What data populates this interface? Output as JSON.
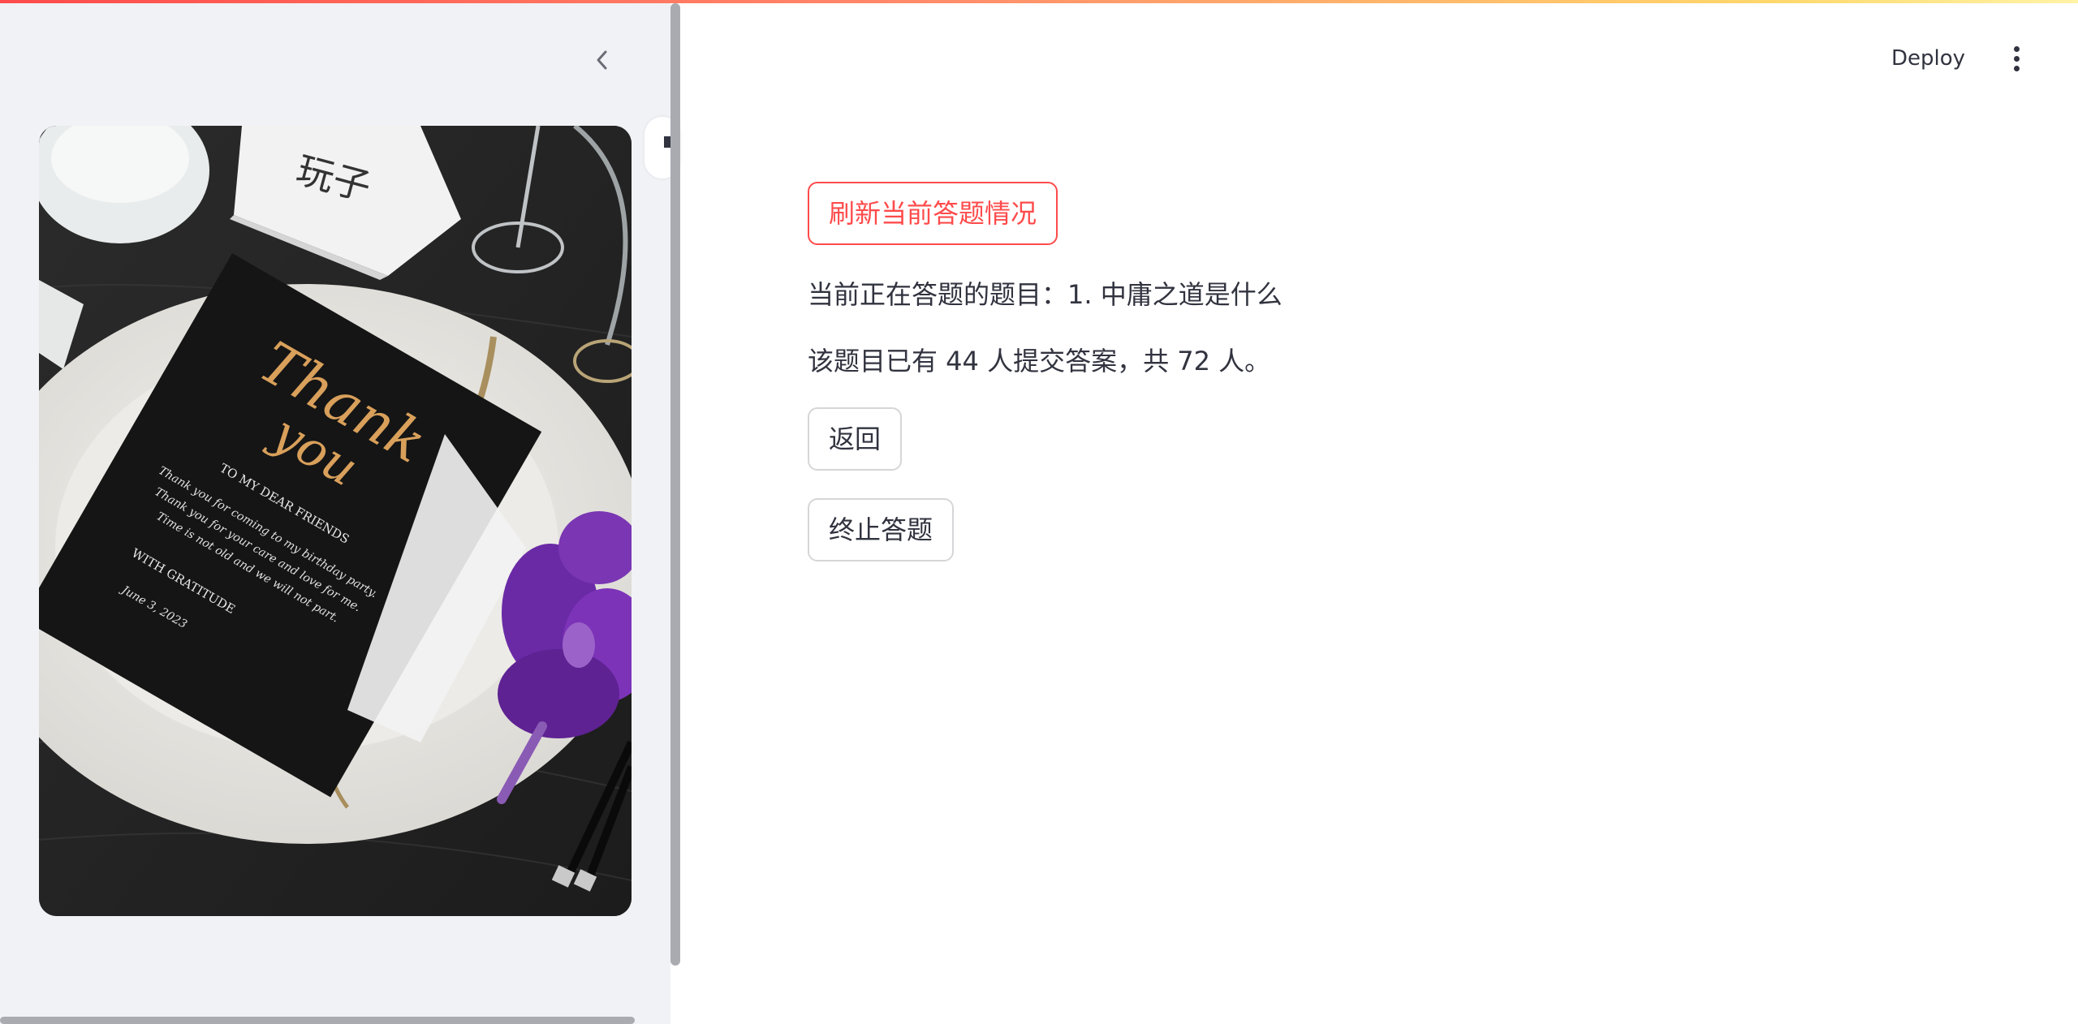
{
  "header": {
    "deploy_label": "Deploy",
    "menu_icon": "vertical-ellipsis-icon"
  },
  "sidebar": {
    "collapse_icon": "chevron-left-icon",
    "image": {
      "place_card_text": "玩子",
      "card_title_line1": "Thank",
      "card_title_line2": "you",
      "card_heading": "TO MY DEAR FRIENDS",
      "card_lines": [
        "Thank you for coming to my birthday party.",
        "Thank you for your care and love for me.",
        "Time is not old and we will not part."
      ],
      "card_signoff": "WITH GRATITUDE",
      "card_date": "June 3, 2023"
    }
  },
  "main": {
    "refresh_button": "刷新当前答题情况",
    "current_question": "当前正在答题的题目：1. 中庸之道是什么",
    "submission_status": "该题目已有 44 人提交答案，共 72 人。",
    "back_button": "返回",
    "stop_button": "终止答题"
  },
  "colors": {
    "accent": "#ff4b4b",
    "sidebar_bg": "#f0f2f6",
    "text": "#31333f"
  }
}
